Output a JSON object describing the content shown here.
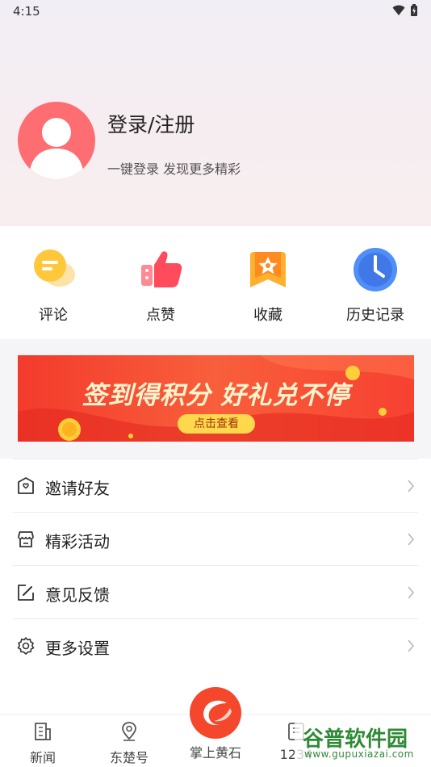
{
  "status_bar": {
    "time": "4:15"
  },
  "profile": {
    "title": "登录/注册",
    "subtitle": "一键登录 发现更多精彩"
  },
  "quick_actions": [
    {
      "label": "评论",
      "icon": "comment-icon"
    },
    {
      "label": "点赞",
      "icon": "thumbs-up-icon"
    },
    {
      "label": "收藏",
      "icon": "favorite-icon"
    },
    {
      "label": "历史记录",
      "icon": "history-clock-icon"
    }
  ],
  "banner": {
    "title": "签到得积分  好礼兑不停",
    "button": "点击查看"
  },
  "menu": [
    {
      "label": "邀请好友",
      "icon": "invite-mail-icon"
    },
    {
      "label": "精彩活动",
      "icon": "store-icon"
    },
    {
      "label": "意见反馈",
      "icon": "edit-icon"
    },
    {
      "label": "更多设置",
      "icon": "gear-icon"
    }
  ],
  "bottom_nav": [
    {
      "label": "新闻",
      "icon": "news-icon"
    },
    {
      "label": "东楚号",
      "icon": "location-pin-icon"
    },
    {
      "label": "掌上黄石",
      "icon": "app-logo-icon"
    },
    {
      "label": "1234",
      "icon": "service-icon"
    }
  ],
  "watermark": {
    "text": "谷普软件园",
    "url": "www.gupuxiazai.com"
  },
  "colors": {
    "accent": "#f4472b",
    "avatar": "#fd6d72",
    "banner": "#f33b2c"
  }
}
